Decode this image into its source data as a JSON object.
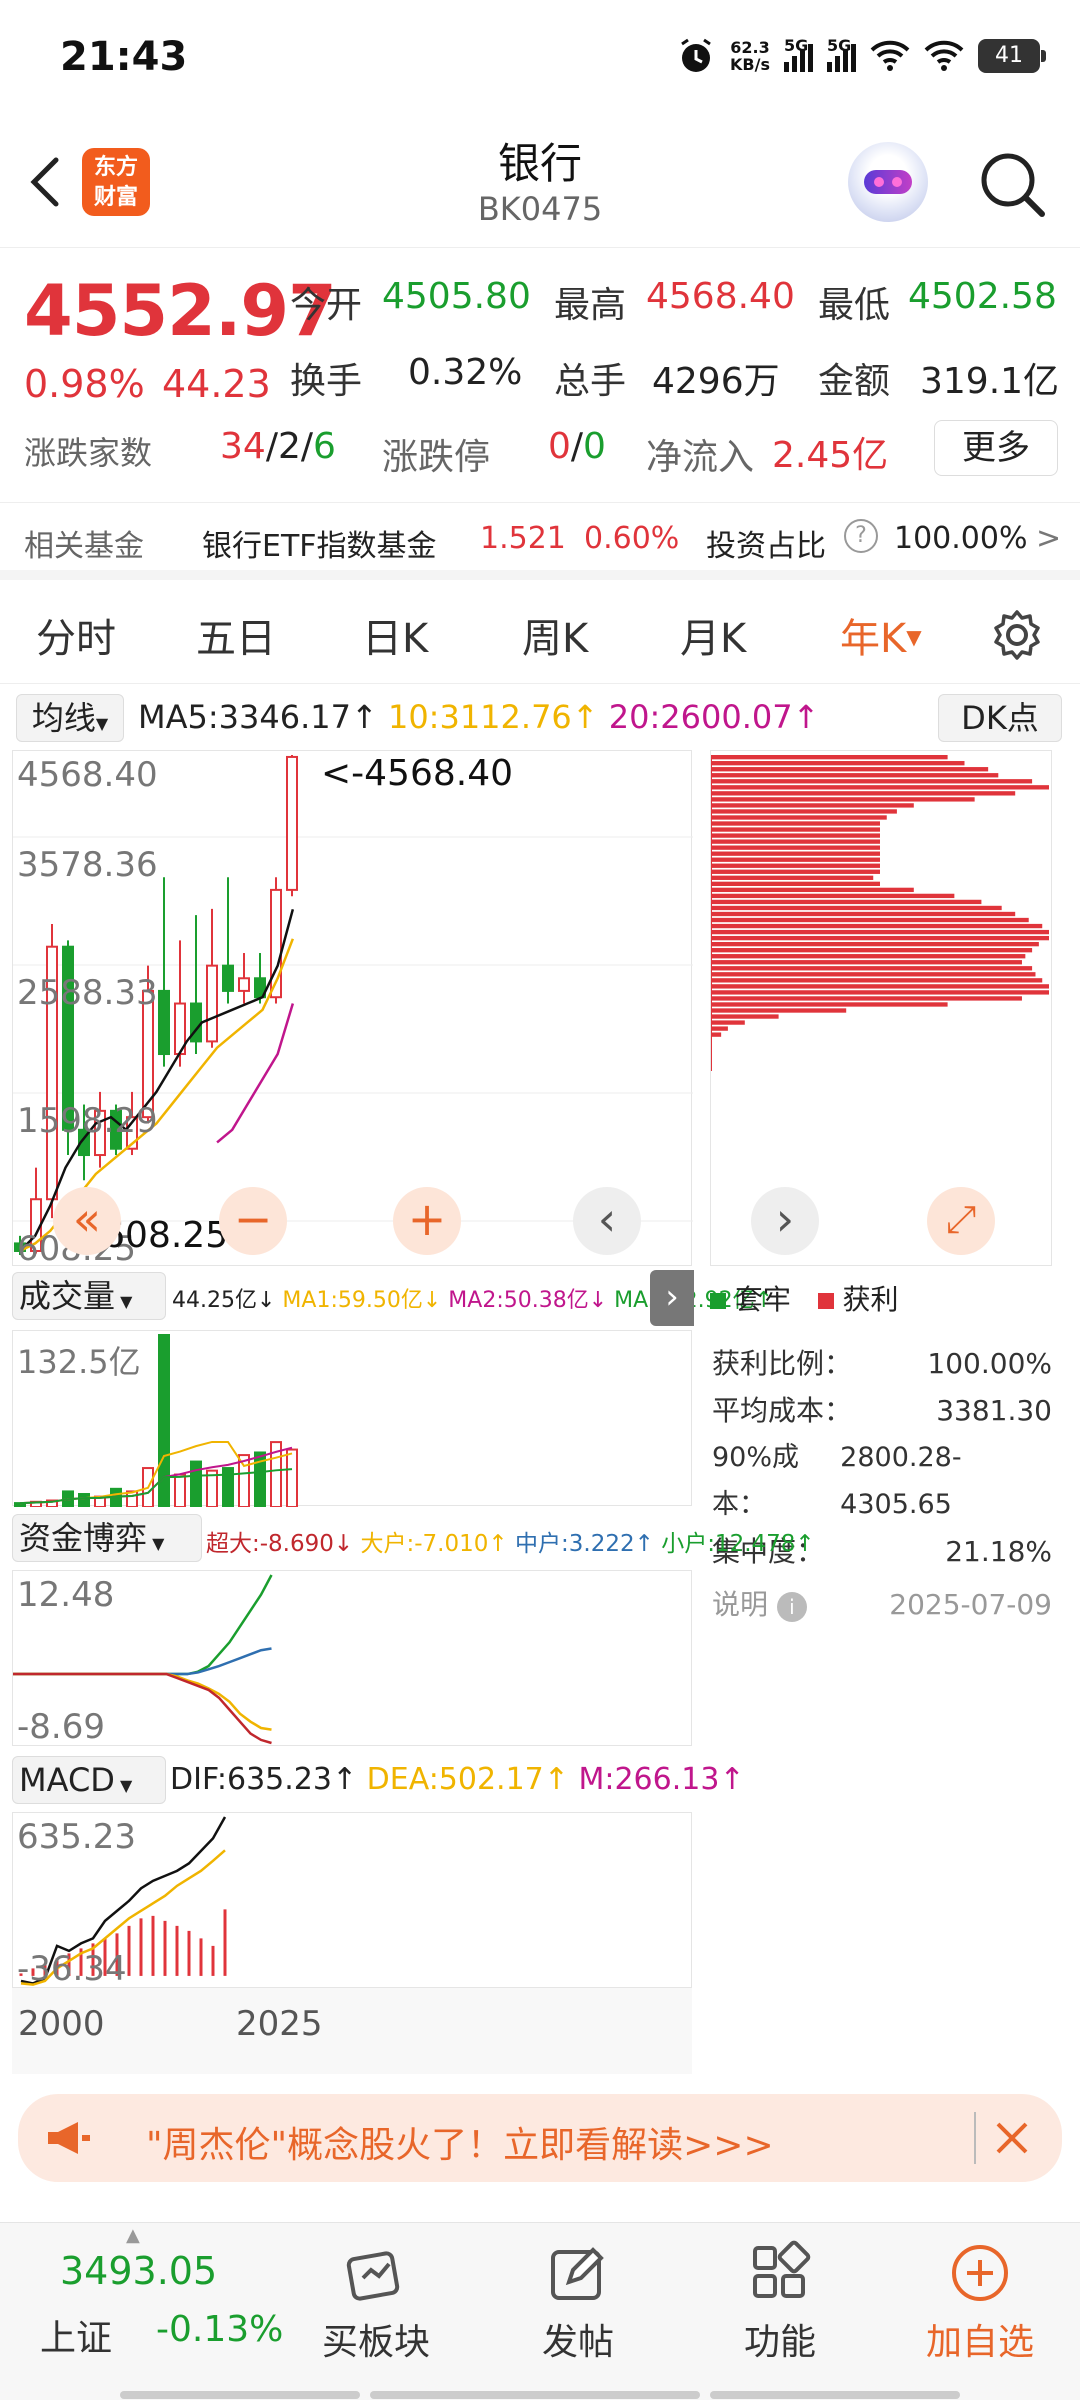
{
  "status_bar": {
    "time": "21:43",
    "net_speed_top": "62.3",
    "net_speed_unit": "KB/s",
    "sim1": "5G",
    "sim2": "5G",
    "battery": "41"
  },
  "header": {
    "title": "银行",
    "code": "BK0475",
    "logo_line1": "东方",
    "logo_line2": "财富"
  },
  "quote": {
    "price": "4552.97",
    "change_pct": "0.98%",
    "change_amt": "44.23",
    "open_label": "今开",
    "open": "4505.80",
    "high_label": "最高",
    "high": "4568.40",
    "low_label": "最低",
    "low": "4502.58",
    "turnover_label": "换手",
    "turnover": "0.32%",
    "volume_label": "总手",
    "volume": "4296万",
    "amount_label": "金额",
    "amount": "319.1亿",
    "updown_label": "涨跌家数",
    "up": "34",
    "flat": "2",
    "down": "6",
    "limit_label": "涨跌停",
    "limit_up": "0",
    "limit_down": "0",
    "netflow_label": "净流入",
    "netflow": "2.45亿",
    "more_label": "更多"
  },
  "fund": {
    "label": "相关基金",
    "name": "银行ETF指数基金",
    "price": "1.521",
    "pct": "0.60%",
    "ratio_label": "投资占比",
    "ratio": "100.00%"
  },
  "tabs": [
    "分时",
    "五日",
    "日K",
    "周K",
    "月K",
    "年K"
  ],
  "active_tab": "年K",
  "ma_bar": {
    "selector": "均线",
    "ma5": "MA5:3346.17",
    "ma10": "10:3112.76",
    "ma20": "20:2600.07",
    "dk": "DK点"
  },
  "kline": {
    "y_labels": [
      "4568.40",
      "3578.36",
      "2588.33",
      "1598.29",
      "608.25"
    ],
    "max_note": "<-4568.40",
    "min_note": "<-608.25"
  },
  "kline_data": [
    {
      "o": 700,
      "c": 640,
      "h": 760,
      "l": 608.25
    },
    {
      "o": 640,
      "c": 1050,
      "h": 1300,
      "l": 620
    },
    {
      "o": 1050,
      "c": 3050,
      "h": 3230,
      "l": 900
    },
    {
      "o": 3050,
      "c": 1600,
      "h": 3100,
      "l": 1400
    },
    {
      "o": 1600,
      "c": 1400,
      "h": 1800,
      "l": 1200
    },
    {
      "o": 1400,
      "c": 1750,
      "h": 1900,
      "l": 1300
    },
    {
      "o": 1750,
      "c": 1450,
      "h": 1800,
      "l": 1400
    },
    {
      "o": 1450,
      "c": 1700,
      "h": 1900,
      "l": 1400
    },
    {
      "o": 1700,
      "c": 2700,
      "h": 2900,
      "l": 1650
    },
    {
      "o": 2700,
      "c": 2200,
      "h": 3600,
      "l": 2100
    },
    {
      "o": 2200,
      "c": 2600,
      "h": 3100,
      "l": 2100
    },
    {
      "o": 2600,
      "c": 2300,
      "h": 3300,
      "l": 2200
    },
    {
      "o": 2300,
      "c": 2900,
      "h": 3350,
      "l": 2250
    },
    {
      "o": 2900,
      "c": 2700,
      "h": 3600,
      "l": 2600
    },
    {
      "o": 2700,
      "c": 2800,
      "h": 3000,
      "l": 2600
    },
    {
      "o": 2800,
      "c": 2650,
      "h": 3000,
      "l": 2600
    },
    {
      "o": 2650,
      "c": 3500,
      "h": 3600,
      "l": 2600
    },
    {
      "o": 3500,
      "c": 4552.97,
      "h": 4568.4,
      "l": 3450
    }
  ],
  "kline_ma": {
    "ma5": [
      640,
      760,
      1000,
      1300,
      1500,
      1650,
      1700,
      1600,
      1750,
      1900,
      2100,
      2300,
      2450,
      2500,
      2550,
      2600,
      2650,
      2900,
      3346.17
    ],
    "ma10": [
      640,
      700,
      800,
      950,
      1100,
      1250,
      1350,
      1450,
      1550,
      1650,
      1800,
      1950,
      2100,
      2250,
      2350,
      2450,
      2550,
      2800,
      3112.76
    ],
    "ma20": [
      1500,
      1600,
      1800,
      2000,
      2200,
      2600.07
    ]
  },
  "dock_buttons": [
    "«",
    "−",
    "+",
    "‹",
    "›",
    "⤢"
  ],
  "chips": {
    "hold_label": "套牢",
    "profit_label": "获利",
    "profit_ratio_label": "获利比例：",
    "profit_ratio": "100.00%",
    "avg_cost_label": "平均成本：",
    "avg_cost": "3381.30",
    "cost90_label": "90%成本：",
    "cost90": "2800.28-4305.65",
    "concentration_label": "集中度：",
    "concentration": "21.18%",
    "note_label": "说明",
    "date": "2025-07-09"
  },
  "chips_profile": [
    0.7,
    0.75,
    0.82,
    0.85,
    0.95,
    1.0,
    0.9,
    0.78,
    0.6,
    0.55,
    0.52,
    0.5,
    0.5,
    0.5,
    0.5,
    0.5,
    0.5,
    0.5,
    0.5,
    0.5,
    0.48,
    0.5,
    0.6,
    0.72,
    0.8,
    0.86,
    0.9,
    0.94,
    0.98,
    1.0,
    1.0,
    0.97,
    0.95,
    0.93,
    0.92,
    0.95,
    0.96,
    0.98,
    1.0,
    1.0,
    0.92,
    0.7,
    0.4,
    0.2,
    0.1,
    0.05,
    0.03
  ],
  "volume": {
    "selector": "成交量",
    "vol": "44.25亿",
    "ma1": "MA1:59.50亿",
    "ma2": "MA2:50.38亿",
    "ma3": "MA3:42.92亿",
    "y_label": "132.5亿"
  },
  "volume_data": [
    3,
    4,
    5,
    12,
    10,
    8,
    14,
    12,
    30,
    132.5,
    25,
    35,
    28,
    30,
    40,
    42,
    50,
    44.25
  ],
  "capital": {
    "selector": "资金博弈",
    "super": "超大:-8.690",
    "large": "大户:-7.010",
    "mid": "中户:3.222",
    "small": "小户:12.478",
    "y_top": "12.48",
    "y_bottom": "-8.69"
  },
  "macd": {
    "selector": "MACD",
    "dif": "DIF:635.23",
    "dea": "DEA:502.17",
    "m": "M:266.13",
    "y_top": "635.23",
    "y_bottom": "-36.34",
    "x_start": "2000",
    "x_end": "2025"
  },
  "macd_bars": [
    10,
    30,
    50,
    70,
    90,
    110,
    130,
    150,
    170,
    200,
    230,
    240,
    220,
    200,
    180,
    150,
    120,
    266.13
  ],
  "banner": {
    "text": "\"周杰伦\"概念股火了！立即看解读>>>"
  },
  "nav": {
    "index_value": "3493.05",
    "index_name": "上证",
    "index_pct": "-0.13%",
    "items": [
      "买板块",
      "发帖",
      "功能",
      "加自选"
    ]
  },
  "colors": {
    "up": "#e0343b",
    "down": "#1a9e2e",
    "accent": "#e8662a",
    "ma5": "#111111",
    "ma10": "#f0b400",
    "ma20": "#c0168c"
  }
}
